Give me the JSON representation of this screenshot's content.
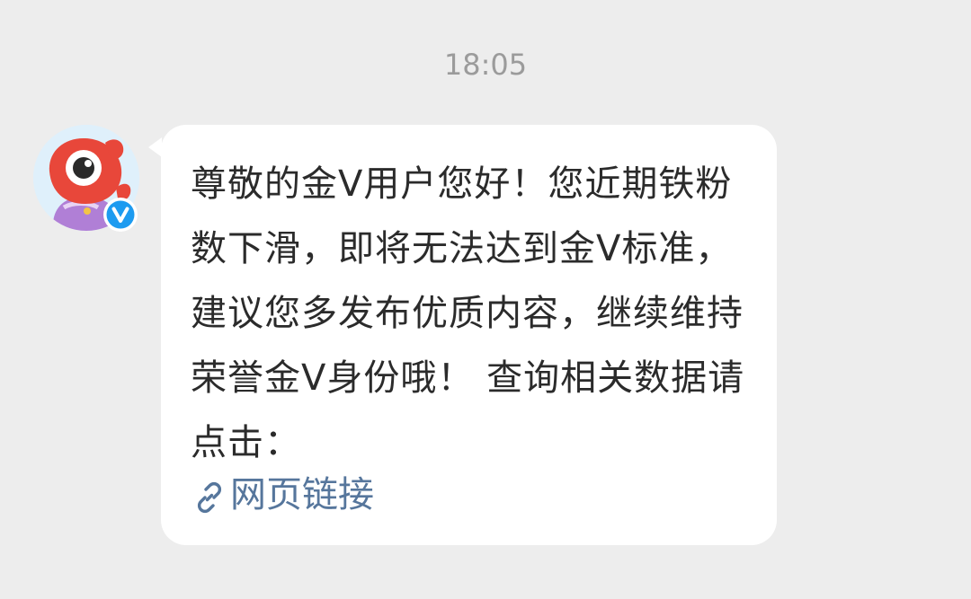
{
  "chat": {
    "timestamp": "18:05",
    "sender": {
      "avatar_icon": "weibo-mascot-avatar-icon",
      "badge_icon": "verified-v-badge-icon",
      "badge_color": "#1d9bf0"
    },
    "message": {
      "text": "尊敬的金V用户您好！您近期铁粉数下滑，即将无法达到金V标准，建议您多发布优质内容，继续维持荣誉金V身份哦！ 查询相关数据请点击：",
      "link": {
        "icon": "link-icon",
        "label": "网页链接",
        "color": "#56769c"
      }
    }
  },
  "colors": {
    "background": "#ededed",
    "bubble": "#ffffff",
    "text": "#2b2b2b",
    "timestamp": "#9b9b9b"
  }
}
